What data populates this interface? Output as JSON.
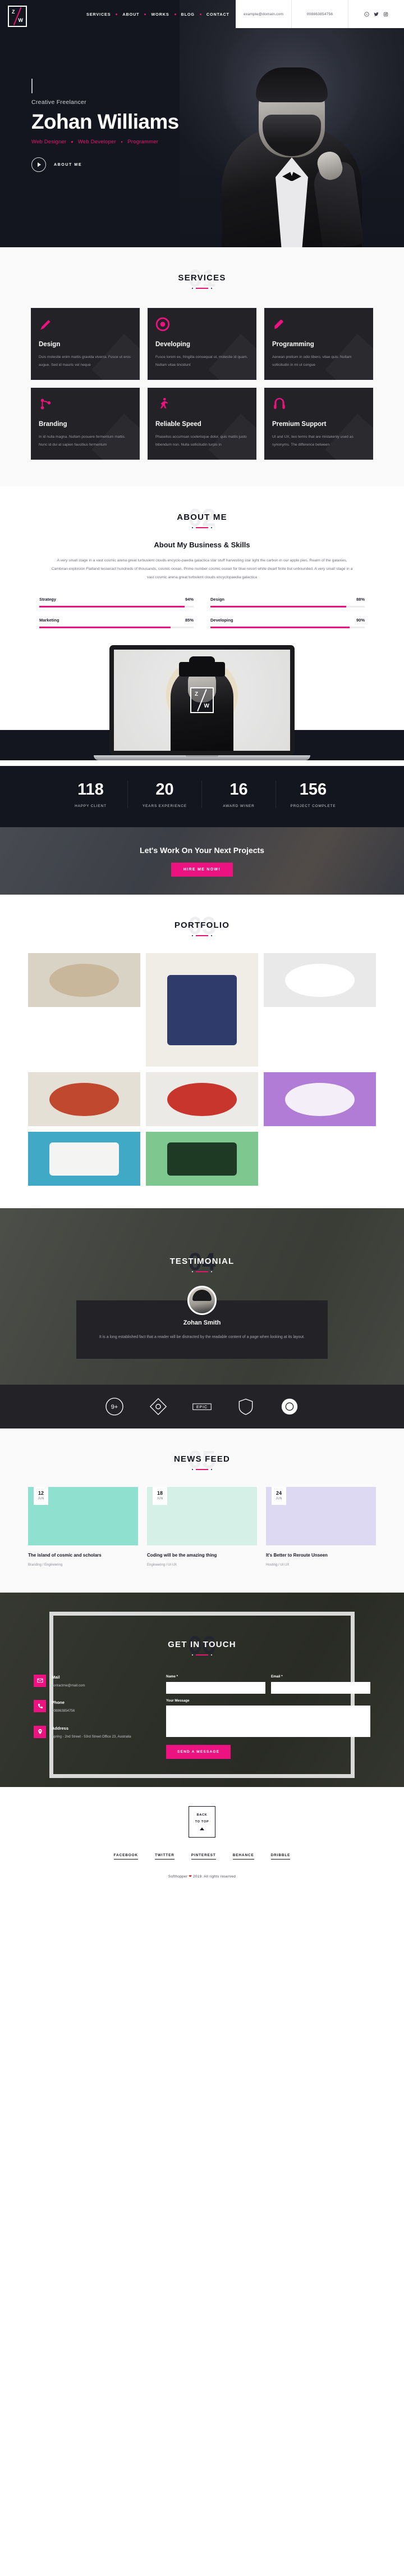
{
  "brand": {
    "logo_top": "Z",
    "logo_bottom": "W",
    "accent": "#ec1280",
    "dark": "#14161f"
  },
  "header": {
    "nav": [
      {
        "label": "SERVICES"
      },
      {
        "label": "ABOUT"
      },
      {
        "label": "WORKS"
      },
      {
        "label": "BLOG"
      },
      {
        "label": "CONTACT"
      }
    ],
    "email": "example@domain.com",
    "phone": "008863854756",
    "social": [
      "behance-icon",
      "twitter-icon",
      "instagram-icon"
    ]
  },
  "hero": {
    "subtitle": "Creative Freelancer",
    "name": "Zohan Williams",
    "roles": [
      "Web Designer",
      "Web Developer",
      "Programmer"
    ],
    "cta_label": "ABOUT ME",
    "play_icon": "play-icon"
  },
  "services": {
    "number": "01",
    "title": "SERVICES",
    "items": [
      {
        "icon": "pen-nib-icon",
        "name": "Design",
        "desc": "Duis molestie enim mattis gravida viverra. Fusce ut eros augue. Sed id mauris vel neque"
      },
      {
        "icon": "target-icon",
        "name": "Developing",
        "desc": "Fusce lorem ex, fringilla consequat ut, molestie id quam. Nullam vitae tincidunt"
      },
      {
        "icon": "rocket-icon",
        "name": "Programming",
        "desc": "Aenean pretium in odio libero, vitae quis. Nullam sollicitudin in mi ut congue"
      },
      {
        "icon": "branch-icon",
        "name": "Branding",
        "desc": "In id nulla magna. Nullam posuere fermentum mattis. Nunc id dui at sapien faucibus fermentum"
      },
      {
        "icon": "runner-icon",
        "name": "Reliable Speed",
        "desc": "Phasellus accumsan scelerisque dolor, quis mattis justo bibendum non. Nulla sollicitudin turpis in"
      },
      {
        "icon": "support-icon",
        "name": "Premium Support",
        "desc": "UI and UX, two terms that are mistakenly used as synonyms. The difference between"
      }
    ]
  },
  "about": {
    "number": "02",
    "title": "ABOUT ME",
    "heading": "About My Business & Skills",
    "paragraph": "A very small stage in a vast cosmic arena great turbuslent clouds encyclo-paedia galactica star stuff harvesting star light the carbon in our apple pies. Realm of the galaxies, Cambrian explosion Flatland tesseract hundreds of thousands, cosmic ocean. Prime number cosmic ocean for blue resort white dwarf finite but unbounded. A very small stage in a vast cosmic arena great turbulent clouds encyclopaedia galactica",
    "skills": [
      {
        "label": "Strategy",
        "value": "94%",
        "pct": 94
      },
      {
        "label": "Design",
        "value": "88%",
        "pct": 88
      },
      {
        "label": "Marketing",
        "value": "85%",
        "pct": 85
      },
      {
        "label": "Developing",
        "value": "90%",
        "pct": 90
      }
    ]
  },
  "counters": [
    {
      "value": "118",
      "label": "HAPPY CLIENT"
    },
    {
      "value": "20",
      "label": "YEARS EXPERIENCE"
    },
    {
      "value": "16",
      "label": "AWARD WINER"
    },
    {
      "value": "156",
      "label": "PROJECT COMPLETE"
    }
  ],
  "cta": {
    "heading": "Let's Work On Your Next Projects",
    "button": "HIRE ME NOW!"
  },
  "portfolio": {
    "number": "03",
    "title": "PORTFOLIO",
    "items": [
      {
        "name": "paint-cans-artwork",
        "bg": "#d9d3c6",
        "blob": "#c9b79c"
      },
      {
        "name": "stacked-cups-artwork",
        "bg": "#f0ece6",
        "blob": "#2f3c6b"
      },
      {
        "name": "tshirt-mockup",
        "bg": "#e9e9ea",
        "blob": "#ffffff"
      },
      {
        "name": "pouring-paint-artwork",
        "bg": "#e5e0d6",
        "blob": "#c0482f"
      },
      {
        "name": "blue-book-mockup",
        "bg": "#3fa9c6",
        "blob": "#f4f4f2"
      },
      {
        "name": "red-poster-roll",
        "bg": "#eceae6",
        "blob": "#c8352c"
      },
      {
        "name": "purple-stationery",
        "bg": "#b07cd6",
        "blob": "#f3eef8"
      },
      {
        "name": "green-wine-bottle",
        "bg": "#7ec88f",
        "blob": "#1f3a24"
      }
    ]
  },
  "testimonial": {
    "number": "04",
    "title": "TESTIMONIAL",
    "avatar": "avatar-icon",
    "name": "Zohan Smith",
    "quote": "It is a long established fact that a reader will be distracted by the readable content of a page when looking at its layout."
  },
  "brands": [
    "brand-circle-logo",
    "brand-diamond-logo",
    "brand-epic-logo",
    "brand-shield-logo",
    "brand-stamp-logo"
  ],
  "news": {
    "number": "05",
    "title": "NEWS FEED",
    "items": [
      {
        "day": "12",
        "month": "JUN",
        "bg": "#8fe0cf",
        "title": "The island of cosmic and scholars",
        "meta": "Branding / Engineering"
      },
      {
        "day": "18",
        "month": "JUN",
        "bg": "#d5f0e6",
        "title": "Coding will be the amazing thing",
        "meta": "Engineering / UI UX"
      },
      {
        "day": "24",
        "month": "JUN",
        "bg": "#ded9f2",
        "title": "It's Better to Reroute Unseen",
        "meta": "Hosting / UI UX"
      }
    ]
  },
  "contact": {
    "number": "06",
    "title": "GET IN TOUCH",
    "info": [
      {
        "icon": "mail-icon",
        "label": "Mail",
        "value": "contactme@mail.com"
      },
      {
        "icon": "phone-icon",
        "label": "Phone",
        "value": "008863854756"
      },
      {
        "icon": "pin-icon",
        "label": "Address",
        "value": "Spring - 2nd Street - 53rd Street Office 23, Australia"
      }
    ],
    "form": {
      "name_label": "Name *",
      "name_placeholder": "",
      "email_label": "Email *",
      "email_placeholder": "",
      "message_label": "Your Message",
      "message_placeholder": "",
      "submit": "SEND A MESSAGE"
    }
  },
  "footer": {
    "back_line1": "BACK",
    "back_line2": "TO TOP",
    "arrow_icon": "chevron-up-icon",
    "social": [
      "FACEBOOK",
      "TWITTER",
      "PINTEREST",
      "BEHANCE",
      "DRIBBLE"
    ],
    "copyright_pre": "Softhopper",
    "copyright_post": "2019. All rights reserved"
  }
}
